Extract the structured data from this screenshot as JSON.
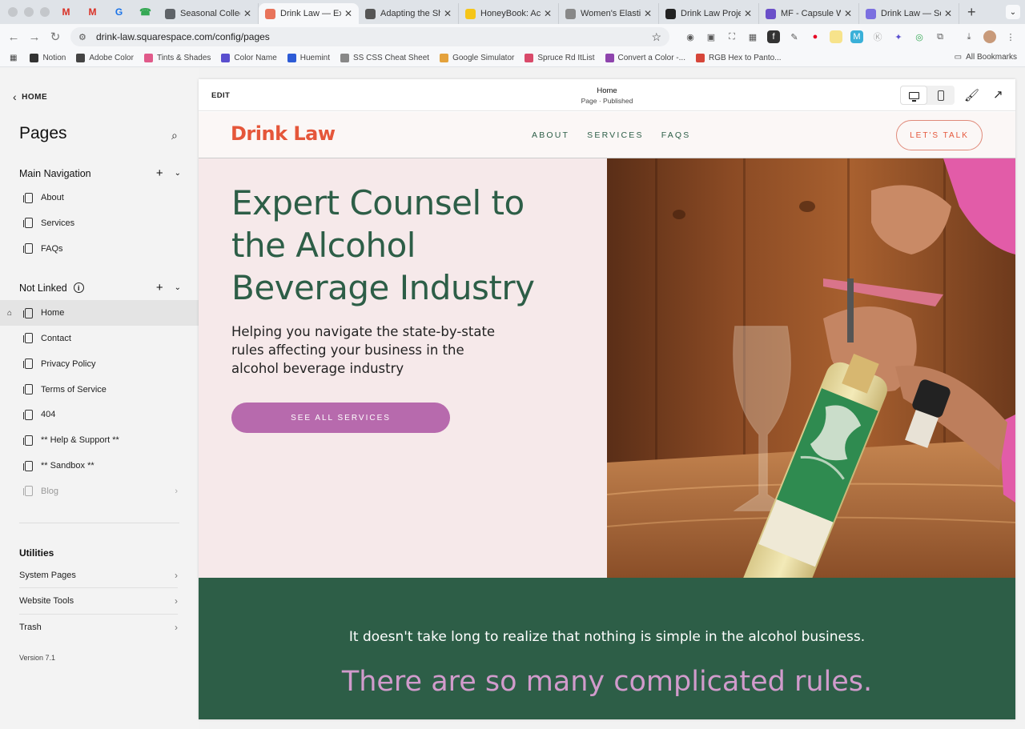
{
  "browser": {
    "pinned_tabs": [
      "M",
      "M",
      "G",
      "☎"
    ],
    "tabs": [
      {
        "label": "Seasonal Collectio",
        "fav_color": "#5f6368"
      },
      {
        "label": "Drink Law — Expe",
        "fav_color": "#e8735a",
        "active": true
      },
      {
        "label": "Adapting the Shir",
        "fav_color": "#555555"
      },
      {
        "label": "HoneyBook: Activ",
        "fav_color": "#f5c518"
      },
      {
        "label": "Women's Elastic V",
        "fav_color": "#888888"
      },
      {
        "label": "Drink Law Project",
        "fav_color": "#222222"
      },
      {
        "label": "MF - Capsule War",
        "fav_color": "#6a4fc9"
      },
      {
        "label": "Drink Law — Squa",
        "fav_color": "#7b6fe0"
      }
    ],
    "url": "drink-law.squarespace.com/config/pages",
    "bookmarks": [
      {
        "label": "Notion",
        "color": "#333333"
      },
      {
        "label": "Adobe Color",
        "color": "#444444"
      },
      {
        "label": "Tints & Shades",
        "color": "#e05a8a"
      },
      {
        "label": "Color Name",
        "color": "#5a4fcf"
      },
      {
        "label": "Huemint",
        "color": "#2d5bd6"
      },
      {
        "label": "SS CSS Cheat Sheet",
        "color": "#888888"
      },
      {
        "label": "Google Simulator",
        "color": "#e4a23c"
      },
      {
        "label": "Spruce Rd ItList",
        "color": "#d94a6a"
      },
      {
        "label": "Convert a Color -...",
        "color": "#8e44ad"
      },
      {
        "label": "RGB Hex to Panto...",
        "color": "#d6463a"
      }
    ],
    "all_bookmarks": "All Bookmarks"
  },
  "sidebar": {
    "back_label": "HOME",
    "title": "Pages",
    "main_nav_label": "Main Navigation",
    "main_nav_items": [
      "About",
      "Services",
      "FAQs"
    ],
    "not_linked_label": "Not Linked",
    "not_linked_items": [
      "Home",
      "Contact",
      "Privacy Policy",
      "Terms of Service",
      "404",
      "** Help & Support **",
      "** Sandbox **",
      "Blog"
    ],
    "utilities_label": "Utilities",
    "utilities": [
      "System Pages",
      "Website Tools",
      "Trash"
    ],
    "version": "Version 7.1"
  },
  "editor": {
    "edit_label": "EDIT",
    "page_name": "Home",
    "page_state": "Page · Published"
  },
  "site": {
    "logo": "Drink Law",
    "nav": [
      "ABOUT",
      "SERVICES",
      "FAQS"
    ],
    "cta": "LET'S TALK",
    "hero_title": "Expert Counsel to the Alcohol Beverage Industry",
    "hero_subtitle": "Helping you navigate the state-by-state rules affecting your business in the alcohol beverage industry",
    "hero_button": "SEE ALL SERVICES",
    "band_line1": "It doesn't take long to realize that nothing is simple in the alcohol business.",
    "band_line2": "There are so many complicated rules."
  },
  "colors": {
    "logo": "#e5563a",
    "green": "#2d5e47",
    "pink_bg": "#f6e9ea",
    "button_purple": "#b76aad",
    "band_accent": "#d19bcc",
    "cta_border": "#e08a7a"
  }
}
